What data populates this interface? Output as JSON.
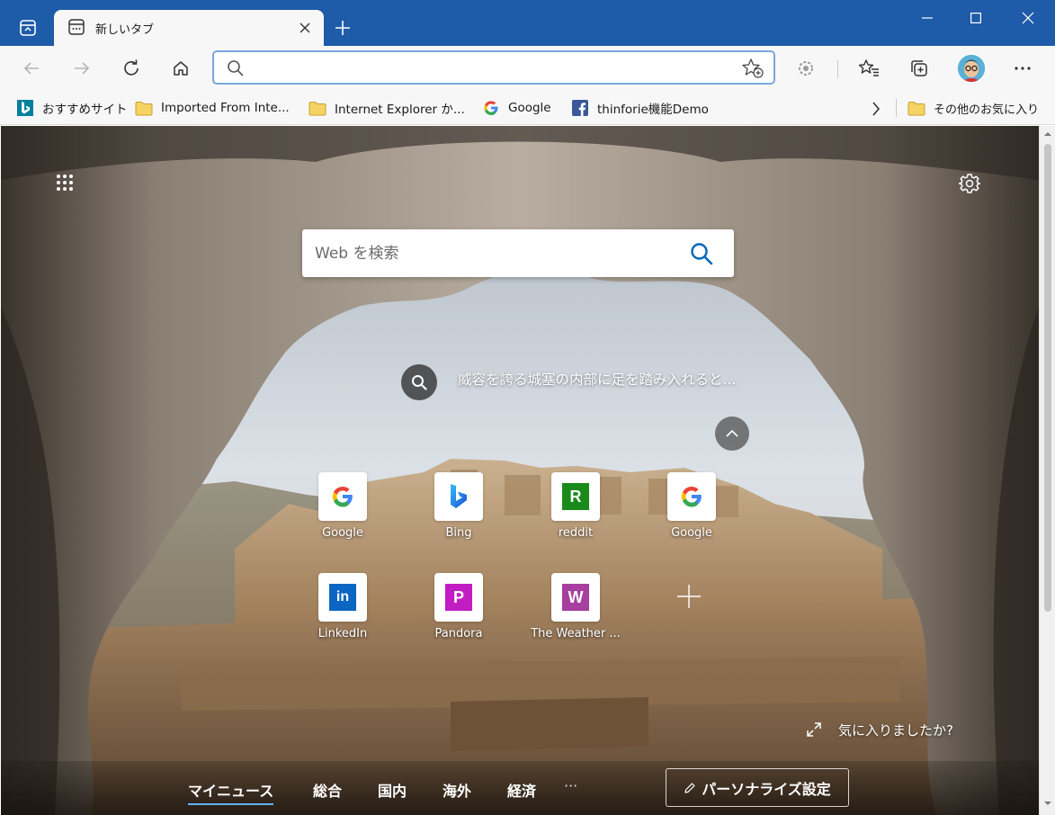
{
  "tab": {
    "title": "新しいタブ"
  },
  "address": {
    "value": "",
    "placeholder": ""
  },
  "favorites": [
    {
      "label": "おすすめサイト",
      "icon": "bing-icon"
    },
    {
      "label": "Imported From Inte...",
      "icon": "folder-icon"
    },
    {
      "label": "Internet Explorer か...",
      "icon": "folder-icon"
    },
    {
      "label": "Google",
      "icon": "google-icon"
    },
    {
      "label": "thinforie機能Demo",
      "icon": "facebook-icon"
    }
  ],
  "other_favorites": "その他のお気に入り",
  "search": {
    "placeholder": "Web を検索"
  },
  "image_info": {
    "text": "威容を誇る城塞の内部に足を踏み入れると..."
  },
  "quick_links": [
    {
      "label": "Google",
      "icon": "google-icon"
    },
    {
      "label": "Bing",
      "icon": "bing-icon"
    },
    {
      "label": "reddit",
      "icon": "reddit-icon",
      "letter": "R",
      "color": "#1a8a1a"
    },
    {
      "label": "Google",
      "icon": "google-icon"
    },
    {
      "label": "LinkedIn",
      "icon": "linkedin-icon",
      "letter": "in",
      "color": "#0a66c2"
    },
    {
      "label": "Pandora",
      "icon": "pandora-icon",
      "letter": "P",
      "color": "#c21dc2"
    },
    {
      "label": "The Weather ...",
      "icon": "weather-icon",
      "letter": "W",
      "color": "#a63f9e"
    }
  ],
  "liked": "気に入りましたか?",
  "news_tabs": [
    "マイニュース",
    "総合",
    "国内",
    "海外",
    "経済"
  ],
  "news_more": "···",
  "personalize": "パーソナライズ設定",
  "colors": {
    "titlebar": "#1e5ba8",
    "accent": "#0067b8"
  }
}
